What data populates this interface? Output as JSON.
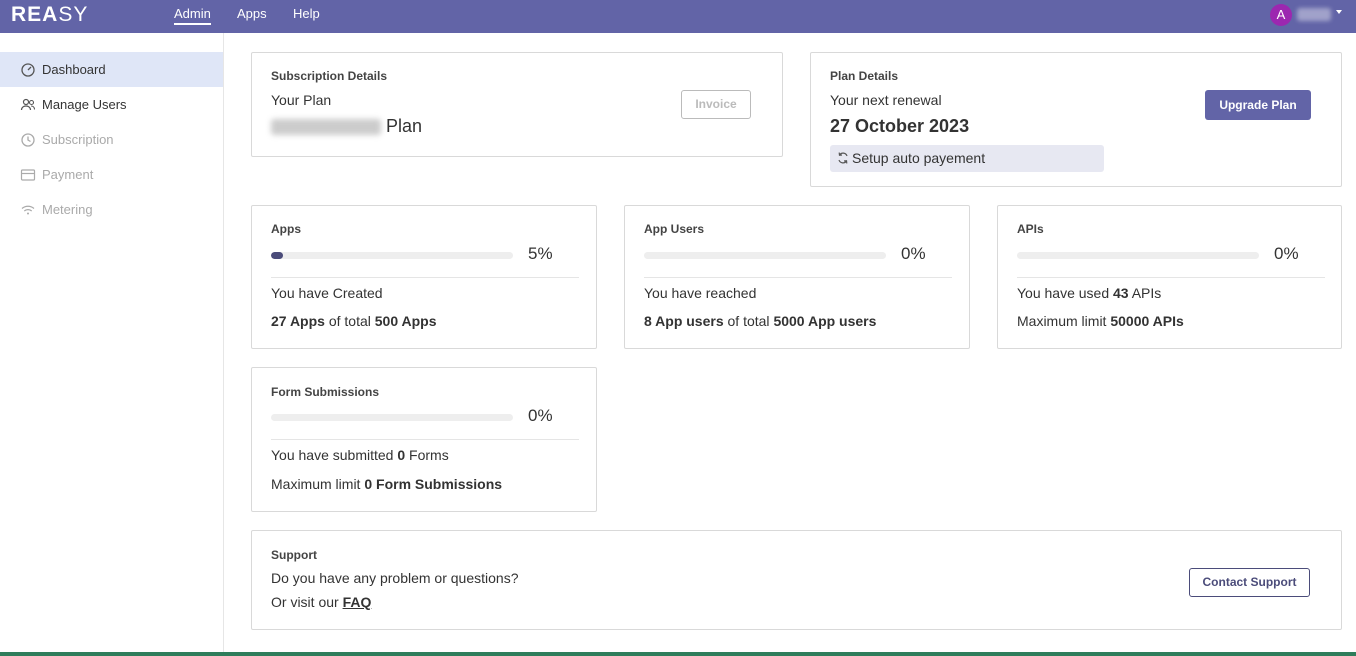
{
  "topbar": {
    "logo_bold": "REA",
    "logo_thin": "SY",
    "nav": [
      "Admin",
      "Apps",
      "Help"
    ],
    "avatar_initial": "A"
  },
  "sidebar": {
    "items": [
      {
        "label": "Dashboard",
        "icon": "dashboard-icon"
      },
      {
        "label": "Manage Users",
        "icon": "users-icon"
      },
      {
        "label": "Subscription",
        "icon": "history-icon"
      },
      {
        "label": "Payment",
        "icon": "card-icon"
      },
      {
        "label": "Metering",
        "icon": "wifi-icon"
      }
    ]
  },
  "subscription": {
    "title": "Subscription Details",
    "your_plan": "Your Plan",
    "plan_suffix": "Plan",
    "invoice": "Invoice"
  },
  "plan": {
    "title": "Plan Details",
    "next_renewal": "Your next renewal",
    "date": "27 October 2023",
    "upgrade": "Upgrade Plan",
    "auto_pay": "Setup auto payement"
  },
  "stats": {
    "apps": {
      "title": "Apps",
      "percent": 5,
      "percent_label": "5%",
      "line1": "You have Created",
      "line2_a": "27 Apps",
      "line2_b": " of total ",
      "line2_c": "500 Apps"
    },
    "app_users": {
      "title": "App Users",
      "percent": 0,
      "percent_label": "0%",
      "line1": "You have reached",
      "line2_a": "8 App users",
      "line2_b": " of total ",
      "line2_c": "5000 App users"
    },
    "apis": {
      "title": "APIs",
      "percent": 0,
      "percent_label": "0%",
      "line1_a": "You have used ",
      "line1_b": "43",
      "line1_c": " APIs",
      "line2_a": "Maximum limit ",
      "line2_b": "50000 APIs"
    },
    "forms": {
      "title": "Form Submissions",
      "percent": 0,
      "percent_label": "0%",
      "line1_a": "You have submitted ",
      "line1_b": "0",
      "line1_c": " Forms",
      "line2_a": "Maximum limit ",
      "line2_b": "0 Form Submissions"
    }
  },
  "support": {
    "title": "Support",
    "question": "Do you have any problem or questions?",
    "visit": "Or visit our ",
    "faq": "FAQ",
    "contact": "Contact Support"
  },
  "colors": {
    "brand": "#6264a7",
    "progress": "#4b4c7a",
    "sidebar_active": "#dfe6f7"
  }
}
